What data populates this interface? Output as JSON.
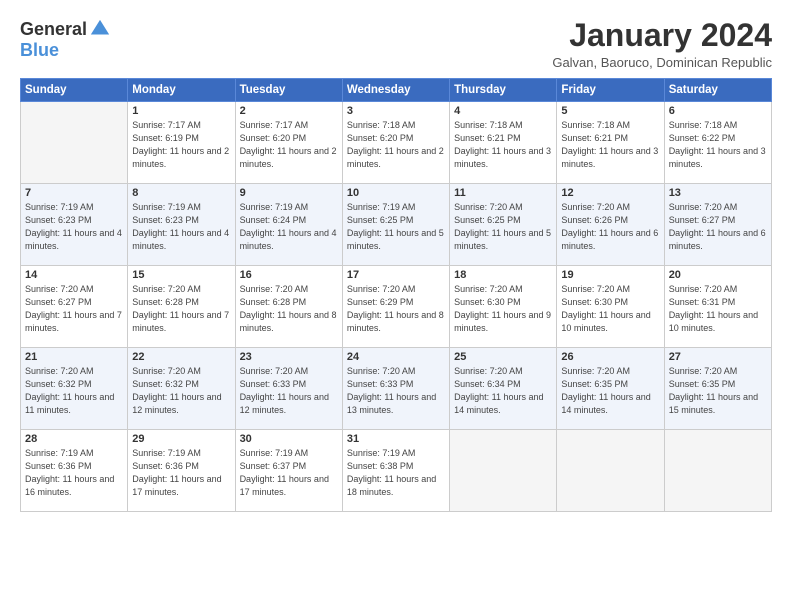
{
  "logo": {
    "general": "General",
    "blue": "Blue"
  },
  "title": "January 2024",
  "location": "Galvan, Baoruco, Dominican Republic",
  "days_of_week": [
    "Sunday",
    "Monday",
    "Tuesday",
    "Wednesday",
    "Thursday",
    "Friday",
    "Saturday"
  ],
  "weeks": [
    [
      {
        "day": "",
        "sunrise": "",
        "sunset": "",
        "daylight": "",
        "empty": true
      },
      {
        "day": "1",
        "sunrise": "Sunrise: 7:17 AM",
        "sunset": "Sunset: 6:19 PM",
        "daylight": "Daylight: 11 hours and 2 minutes."
      },
      {
        "day": "2",
        "sunrise": "Sunrise: 7:17 AM",
        "sunset": "Sunset: 6:20 PM",
        "daylight": "Daylight: 11 hours and 2 minutes."
      },
      {
        "day": "3",
        "sunrise": "Sunrise: 7:18 AM",
        "sunset": "Sunset: 6:20 PM",
        "daylight": "Daylight: 11 hours and 2 minutes."
      },
      {
        "day": "4",
        "sunrise": "Sunrise: 7:18 AM",
        "sunset": "Sunset: 6:21 PM",
        "daylight": "Daylight: 11 hours and 3 minutes."
      },
      {
        "day": "5",
        "sunrise": "Sunrise: 7:18 AM",
        "sunset": "Sunset: 6:21 PM",
        "daylight": "Daylight: 11 hours and 3 minutes."
      },
      {
        "day": "6",
        "sunrise": "Sunrise: 7:18 AM",
        "sunset": "Sunset: 6:22 PM",
        "daylight": "Daylight: 11 hours and 3 minutes."
      }
    ],
    [
      {
        "day": "7",
        "sunrise": "Sunrise: 7:19 AM",
        "sunset": "Sunset: 6:23 PM",
        "daylight": "Daylight: 11 hours and 4 minutes."
      },
      {
        "day": "8",
        "sunrise": "Sunrise: 7:19 AM",
        "sunset": "Sunset: 6:23 PM",
        "daylight": "Daylight: 11 hours and 4 minutes."
      },
      {
        "day": "9",
        "sunrise": "Sunrise: 7:19 AM",
        "sunset": "Sunset: 6:24 PM",
        "daylight": "Daylight: 11 hours and 4 minutes."
      },
      {
        "day": "10",
        "sunrise": "Sunrise: 7:19 AM",
        "sunset": "Sunset: 6:25 PM",
        "daylight": "Daylight: 11 hours and 5 minutes."
      },
      {
        "day": "11",
        "sunrise": "Sunrise: 7:20 AM",
        "sunset": "Sunset: 6:25 PM",
        "daylight": "Daylight: 11 hours and 5 minutes."
      },
      {
        "day": "12",
        "sunrise": "Sunrise: 7:20 AM",
        "sunset": "Sunset: 6:26 PM",
        "daylight": "Daylight: 11 hours and 6 minutes."
      },
      {
        "day": "13",
        "sunrise": "Sunrise: 7:20 AM",
        "sunset": "Sunset: 6:27 PM",
        "daylight": "Daylight: 11 hours and 6 minutes."
      }
    ],
    [
      {
        "day": "14",
        "sunrise": "Sunrise: 7:20 AM",
        "sunset": "Sunset: 6:27 PM",
        "daylight": "Daylight: 11 hours and 7 minutes."
      },
      {
        "day": "15",
        "sunrise": "Sunrise: 7:20 AM",
        "sunset": "Sunset: 6:28 PM",
        "daylight": "Daylight: 11 hours and 7 minutes."
      },
      {
        "day": "16",
        "sunrise": "Sunrise: 7:20 AM",
        "sunset": "Sunset: 6:28 PM",
        "daylight": "Daylight: 11 hours and 8 minutes."
      },
      {
        "day": "17",
        "sunrise": "Sunrise: 7:20 AM",
        "sunset": "Sunset: 6:29 PM",
        "daylight": "Daylight: 11 hours and 8 minutes."
      },
      {
        "day": "18",
        "sunrise": "Sunrise: 7:20 AM",
        "sunset": "Sunset: 6:30 PM",
        "daylight": "Daylight: 11 hours and 9 minutes."
      },
      {
        "day": "19",
        "sunrise": "Sunrise: 7:20 AM",
        "sunset": "Sunset: 6:30 PM",
        "daylight": "Daylight: 11 hours and 10 minutes."
      },
      {
        "day": "20",
        "sunrise": "Sunrise: 7:20 AM",
        "sunset": "Sunset: 6:31 PM",
        "daylight": "Daylight: 11 hours and 10 minutes."
      }
    ],
    [
      {
        "day": "21",
        "sunrise": "Sunrise: 7:20 AM",
        "sunset": "Sunset: 6:32 PM",
        "daylight": "Daylight: 11 hours and 11 minutes."
      },
      {
        "day": "22",
        "sunrise": "Sunrise: 7:20 AM",
        "sunset": "Sunset: 6:32 PM",
        "daylight": "Daylight: 11 hours and 12 minutes."
      },
      {
        "day": "23",
        "sunrise": "Sunrise: 7:20 AM",
        "sunset": "Sunset: 6:33 PM",
        "daylight": "Daylight: 11 hours and 12 minutes."
      },
      {
        "day": "24",
        "sunrise": "Sunrise: 7:20 AM",
        "sunset": "Sunset: 6:33 PM",
        "daylight": "Daylight: 11 hours and 13 minutes."
      },
      {
        "day": "25",
        "sunrise": "Sunrise: 7:20 AM",
        "sunset": "Sunset: 6:34 PM",
        "daylight": "Daylight: 11 hours and 14 minutes."
      },
      {
        "day": "26",
        "sunrise": "Sunrise: 7:20 AM",
        "sunset": "Sunset: 6:35 PM",
        "daylight": "Daylight: 11 hours and 14 minutes."
      },
      {
        "day": "27",
        "sunrise": "Sunrise: 7:20 AM",
        "sunset": "Sunset: 6:35 PM",
        "daylight": "Daylight: 11 hours and 15 minutes."
      }
    ],
    [
      {
        "day": "28",
        "sunrise": "Sunrise: 7:19 AM",
        "sunset": "Sunset: 6:36 PM",
        "daylight": "Daylight: 11 hours and 16 minutes."
      },
      {
        "day": "29",
        "sunrise": "Sunrise: 7:19 AM",
        "sunset": "Sunset: 6:36 PM",
        "daylight": "Daylight: 11 hours and 17 minutes."
      },
      {
        "day": "30",
        "sunrise": "Sunrise: 7:19 AM",
        "sunset": "Sunset: 6:37 PM",
        "daylight": "Daylight: 11 hours and 17 minutes."
      },
      {
        "day": "31",
        "sunrise": "Sunrise: 7:19 AM",
        "sunset": "Sunset: 6:38 PM",
        "daylight": "Daylight: 11 hours and 18 minutes."
      },
      {
        "day": "",
        "sunrise": "",
        "sunset": "",
        "daylight": "",
        "empty": true
      },
      {
        "day": "",
        "sunrise": "",
        "sunset": "",
        "daylight": "",
        "empty": true
      },
      {
        "day": "",
        "sunrise": "",
        "sunset": "",
        "daylight": "",
        "empty": true
      }
    ]
  ]
}
